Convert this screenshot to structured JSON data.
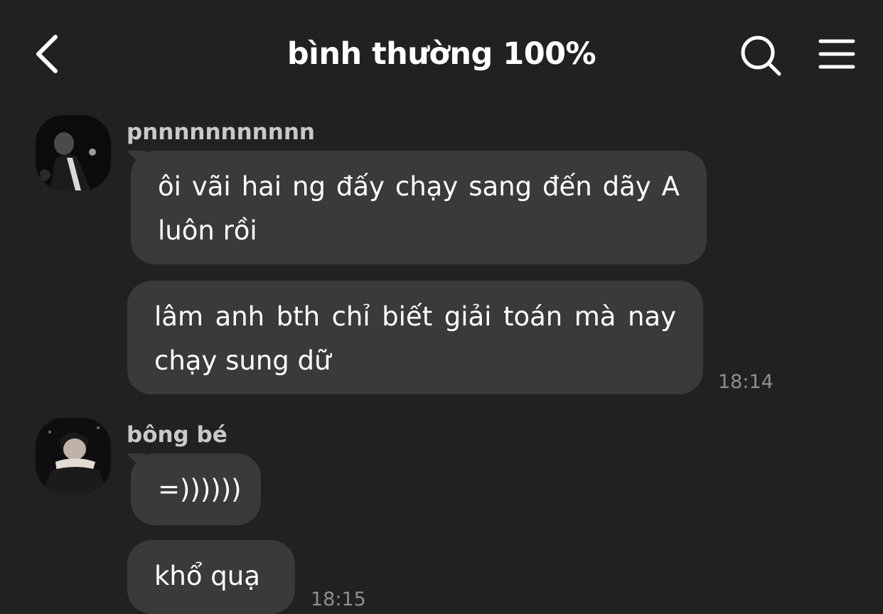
{
  "header": {
    "title": "bình thường 100%",
    "back_icon": "chevron-left-icon",
    "search_icon": "search-icon",
    "menu_icon": "hamburger-menu-icon"
  },
  "messages": [
    {
      "sender": "pnnnnnnnnnnn",
      "bubbles": [
        "ôi vãi hai ng đấy chạy sang đến dãy A luôn rồi",
        "lâm anh bth chỉ biết giải toán mà nay chạy sung dữ"
      ],
      "time": "18:14"
    },
    {
      "sender": "bông bé",
      "bubbles": [
        "=))))))",
        "khổ quạ"
      ],
      "time": "18:15"
    }
  ],
  "colors": {
    "background": "#212121",
    "bubble": "#3a3a3a",
    "sender_name": "#c9c9c9",
    "timestamp": "#8e8e8e",
    "text": "#ffffff"
  }
}
